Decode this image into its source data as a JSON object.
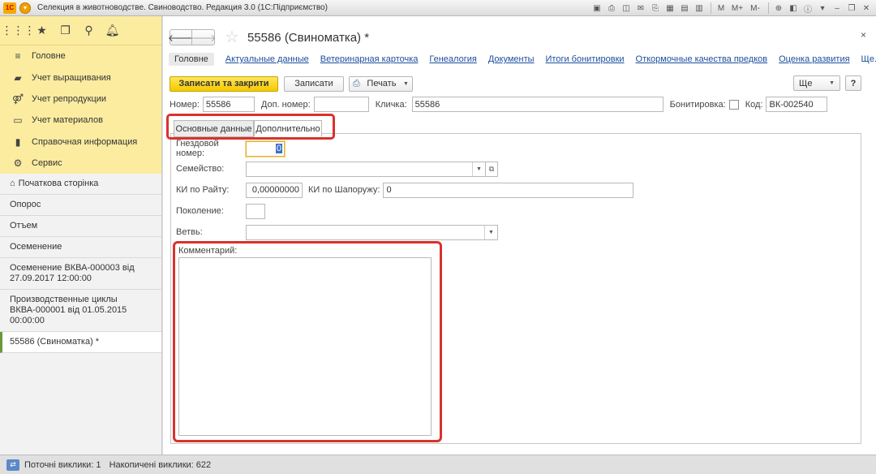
{
  "window": {
    "title": "Селекция в животноводстве. Свиноводство. Редакция 3.0  (1С:Підприємство)",
    "logo_text": "1С",
    "toolbar_icons": [
      "save-icon",
      "print-icon",
      "preview-icon",
      "mail-icon",
      "attach-icon",
      "calendar-icon",
      "calculator-icon",
      "calendar2-icon",
      "m-icon",
      "m-plus-icon",
      "m-minus-icon",
      "zoom-icon",
      "panel-icon",
      "info-icon",
      "menu-icon",
      "minimize-icon",
      "restore-icon",
      "close-icon"
    ],
    "memory_labels": [
      "M",
      "M+",
      "M-"
    ]
  },
  "sidebar": {
    "toolbar": [
      "apps-icon",
      "star-icon",
      "history-icon",
      "search-icon",
      "bell-icon"
    ],
    "sections": [
      {
        "label": "Головне",
        "icon": "menu-lines-icon"
      },
      {
        "label": "Учет выращивания",
        "icon": "pig-icon"
      },
      {
        "label": "Учет репродукции",
        "icon": "reproduction-icon"
      },
      {
        "label": "Учет материалов",
        "icon": "money-icon"
      },
      {
        "label": "Справочная информация",
        "icon": "book-icon"
      },
      {
        "label": "Сервис",
        "icon": "gear-icon"
      }
    ],
    "open_windows": [
      {
        "label": "Початкова сторінка"
      },
      {
        "label": "Опорос"
      },
      {
        "label": "Отъем"
      },
      {
        "label": "Осеменение"
      },
      {
        "label": "Осеменение ВКВА-000003 від 27.09.2017 12:00:00"
      },
      {
        "label": "Производственные циклы ВКВА-000001 від 01.05.2015 00:00:00"
      },
      {
        "label": "55586 (Свиноматка) *"
      }
    ]
  },
  "form": {
    "title": "55586 (Свиноматка) *",
    "close_symbol": "×",
    "links": [
      "Головне",
      "Актуальные данные",
      "Ветеринарная карточка",
      "Генеалогия",
      "Документы",
      "Итоги бонитировки",
      "Откормочные качества предков",
      "Оценка развития",
      "Ще..."
    ],
    "commands": {
      "write_close": "Записати та закрити",
      "write": "Записати",
      "print": "Печать",
      "more": "Ще",
      "help": "?"
    },
    "header": {
      "number_label": "Номер:",
      "number_value": "55586",
      "extra_number_label": "Доп. номер:",
      "extra_number_value": "",
      "nickname_label": "Кличка:",
      "nickname_value": "55586",
      "bonitation_label": "Бонитировка:",
      "bonitation_checked": false,
      "code_label": "Код:",
      "code_value": "ВК-002540"
    },
    "tabs": [
      "Основные данные",
      "Дополнительно"
    ],
    "active_tab": "Дополнительно",
    "fields": {
      "nest_number_label": "Гнездовой номер:",
      "nest_number_value": "0",
      "family_label": "Семейство:",
      "family_value": "",
      "ki_wright_label": "КИ по Райту:",
      "ki_wright_value": "0,00000000",
      "ki_shaporuzh_label": "КИ по Шапоружу:",
      "ki_shaporuzh_value": "0",
      "generation_label": "Поколение:",
      "generation_value": "",
      "branch_label": "Ветвь:",
      "branch_value": "",
      "comment_label": "Комментарий:",
      "comment_value": ""
    }
  },
  "statusbar": {
    "current_calls_label": "Поточні виклики: 1",
    "accumulated_calls_label": "Накопичені виклики: 622"
  },
  "colors": {
    "highlight_frame": "#d9322c",
    "sidebar_yellow": "#fbeca0",
    "primary_button": "#f4c800",
    "link": "#1b4f9c"
  }
}
